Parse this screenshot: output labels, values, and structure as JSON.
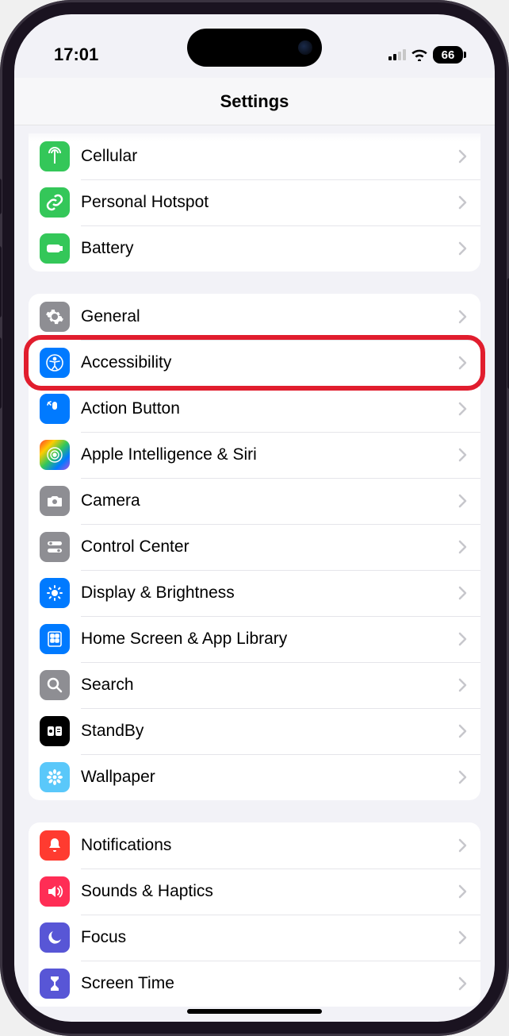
{
  "status": {
    "time": "17:01",
    "battery": "66"
  },
  "header": {
    "title": "Settings"
  },
  "groups": [
    {
      "id": "connectivity",
      "partial": true,
      "rows": [
        {
          "id": "cellular",
          "label": "Cellular",
          "icon": "antenna",
          "color": "green"
        },
        {
          "id": "hotspot",
          "label": "Personal Hotspot",
          "icon": "link",
          "color": "green"
        },
        {
          "id": "battery",
          "label": "Battery",
          "icon": "battery",
          "color": "green"
        }
      ]
    },
    {
      "id": "device",
      "rows": [
        {
          "id": "general",
          "label": "General",
          "icon": "gear",
          "color": "gray"
        },
        {
          "id": "accessibility",
          "label": "Accessibility",
          "icon": "accessibility",
          "color": "blue",
          "highlighted": true
        },
        {
          "id": "action-button",
          "label": "Action Button",
          "icon": "action",
          "color": "blue"
        },
        {
          "id": "siri",
          "label": "Apple Intelligence & Siri",
          "icon": "siri",
          "color": "rainbow"
        },
        {
          "id": "camera",
          "label": "Camera",
          "icon": "camera",
          "color": "gray"
        },
        {
          "id": "control-center",
          "label": "Control Center",
          "icon": "switches",
          "color": "gray"
        },
        {
          "id": "display",
          "label": "Display & Brightness",
          "icon": "sun",
          "color": "blue"
        },
        {
          "id": "home-screen",
          "label": "Home Screen & App Library",
          "icon": "apps",
          "color": "blue"
        },
        {
          "id": "search",
          "label": "Search",
          "icon": "search",
          "color": "gray"
        },
        {
          "id": "standby",
          "label": "StandBy",
          "icon": "standby",
          "color": "black"
        },
        {
          "id": "wallpaper",
          "label": "Wallpaper",
          "icon": "flower",
          "color": "teal"
        }
      ]
    },
    {
      "id": "attention",
      "rows": [
        {
          "id": "notifications",
          "label": "Notifications",
          "icon": "bell",
          "color": "red"
        },
        {
          "id": "sounds",
          "label": "Sounds & Haptics",
          "icon": "speaker",
          "color": "pink"
        },
        {
          "id": "focus",
          "label": "Focus",
          "icon": "moon",
          "color": "indigo"
        },
        {
          "id": "screen-time",
          "label": "Screen Time",
          "icon": "hourglass",
          "color": "indigo"
        }
      ]
    }
  ]
}
